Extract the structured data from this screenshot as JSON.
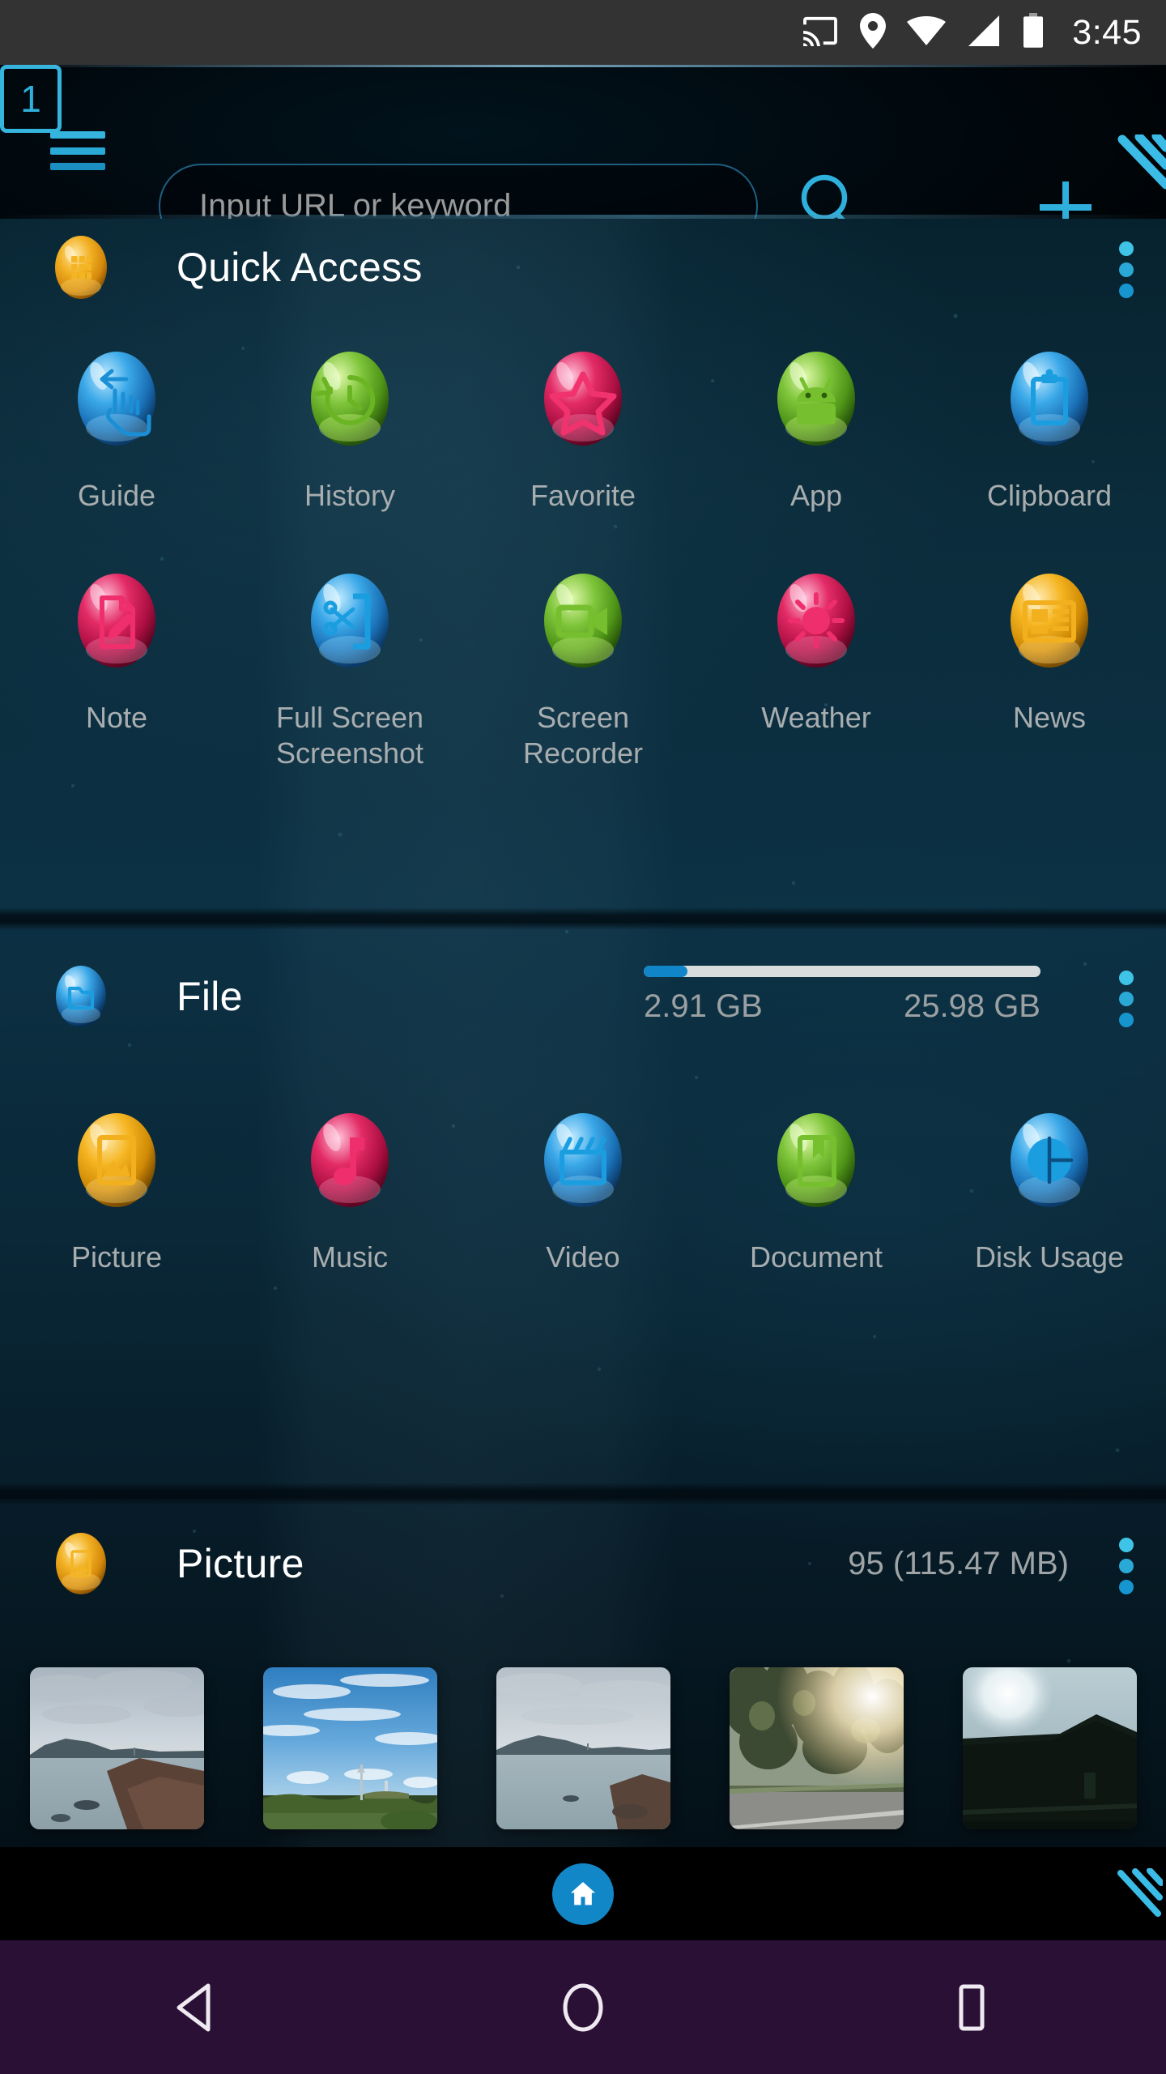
{
  "status_bar": {
    "icons": [
      "cast-icon",
      "location-icon",
      "wifi-icon",
      "signal-icon",
      "battery-icon"
    ],
    "time": "3:45"
  },
  "browser_toolbar": {
    "menu_icon": "hamburger-menu-icon",
    "url_placeholder": "Input URL or keyword",
    "url_value": "",
    "search_icon": "search-icon",
    "tab_count": "1",
    "new_tab_icon": "plus-icon",
    "accent_color": "#35b4dd"
  },
  "quick_access": {
    "title": "Quick Access",
    "header_icon": "grid-apps-icon",
    "overflow_icon": "more-vertical-icon",
    "items": [
      {
        "label": "Guide",
        "icon": "swipe-hand-icon",
        "color": "#2f9fe0"
      },
      {
        "label": "History",
        "icon": "clock-history-icon",
        "color": "#7dc242"
      },
      {
        "label": "Favorite",
        "icon": "star-icon",
        "color": "#e0245e"
      },
      {
        "label": "App",
        "icon": "android-robot-icon",
        "color": "#7dc242"
      },
      {
        "label": "Clipboard",
        "icon": "clipboard-icon",
        "color": "#2f9fe0"
      },
      {
        "label": "Note",
        "icon": "note-pencil-icon",
        "color": "#e0245e"
      },
      {
        "label": "Full Screen Screenshot",
        "icon": "scissors-phone-icon",
        "color": "#2f9fe0"
      },
      {
        "label": "Screen Recorder",
        "icon": "video-camera-icon",
        "color": "#7dc242"
      },
      {
        "label": "Weather",
        "icon": "sun-icon",
        "color": "#e0245e"
      },
      {
        "label": "News",
        "icon": "newspaper-icon",
        "color": "#f0a81e"
      }
    ]
  },
  "file_section": {
    "title": "File",
    "header_icon": "folder-icon",
    "overflow_icon": "more-vertical-icon",
    "storage_used": "2.91 GB",
    "storage_total": "25.98 GB",
    "storage_percent": 11,
    "bar_fill_color": "#1086c8",
    "bar_track_color": "#d8dcdd",
    "items": [
      {
        "label": "Picture",
        "icon": "image-icon",
        "color": "#f0a81e"
      },
      {
        "label": "Music",
        "icon": "music-note-icon",
        "color": "#e0245e"
      },
      {
        "label": "Video",
        "icon": "clapperboard-icon",
        "color": "#2f9fe0"
      },
      {
        "label": "Document",
        "icon": "book-icon",
        "color": "#7dc242"
      },
      {
        "label": "Disk Usage",
        "icon": "pie-chart-icon",
        "color": "#2f9fe0"
      }
    ]
  },
  "picture_section": {
    "title": "Picture",
    "header_icon": "image-icon",
    "overflow_icon": "more-vertical-icon",
    "count_label": "95 (115.47 MB)",
    "thumbnails": [
      {
        "name": "coastline-with-island-and-clouds"
      },
      {
        "name": "blue-sky-with-tower-and-field"
      },
      {
        "name": "sea-with-rocks-and-island"
      },
      {
        "name": "roadside-trees-with-sun-flare"
      },
      {
        "name": "dark-landscape-with-bright-sun"
      }
    ]
  },
  "bottom_bar": {
    "home_icon": "home-icon",
    "stripes_icon": "diagonal-stripes-icon"
  },
  "nav_bar": {
    "back_icon": "back-triangle-icon",
    "home_icon": "home-circle-icon",
    "recents_icon": "recents-square-icon"
  }
}
